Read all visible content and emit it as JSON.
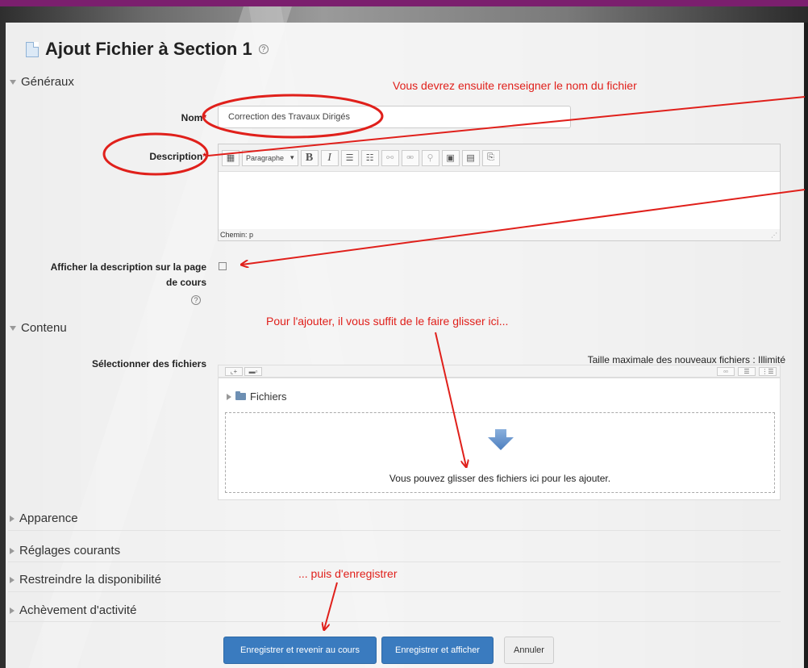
{
  "page": {
    "title": "Ajout Fichier à Section 1",
    "help_glyph": "?"
  },
  "sections": {
    "general": "Généraux",
    "content": "Contenu",
    "appearance": "Apparence",
    "common_settings": "Réglages courants",
    "restrict": "Restreindre la disponibilité",
    "completion": "Achèvement d'activité"
  },
  "form": {
    "name_label": "Nom",
    "name_value": "Correction des Travaux Dirigés",
    "description_label": "Description",
    "required_mark": "*",
    "editor_format": "Paragraphe",
    "editor_path": "Chemin: p",
    "show_description_label_1": "Afficher la description sur la page",
    "show_description_label_2": "de cours",
    "show_description_checked": false,
    "files_label": "Sélectionner des fichiers",
    "max_size": "Taille maximale des nouveaux fichiers : Illimité",
    "files_folder": "Fichiers",
    "drop_text": "Vous pouvez glisser des fichiers ici pour les ajouter."
  },
  "annotations": {
    "name_hint": "Vous devrez ensuite renseigner le nom du fichier",
    "drag_hint": "Pour l'ajouter, il vous suffit de le faire glisser ici...",
    "save_hint": "... puis d'enregistrer",
    "color": "#e0201b"
  },
  "buttons": {
    "save_return": "Enregistrer et revenir au cours",
    "save_display": "Enregistrer et afficher",
    "cancel": "Annuler"
  },
  "colors": {
    "primary": "#3a7bbf",
    "topbar": "#7b1f6e"
  }
}
